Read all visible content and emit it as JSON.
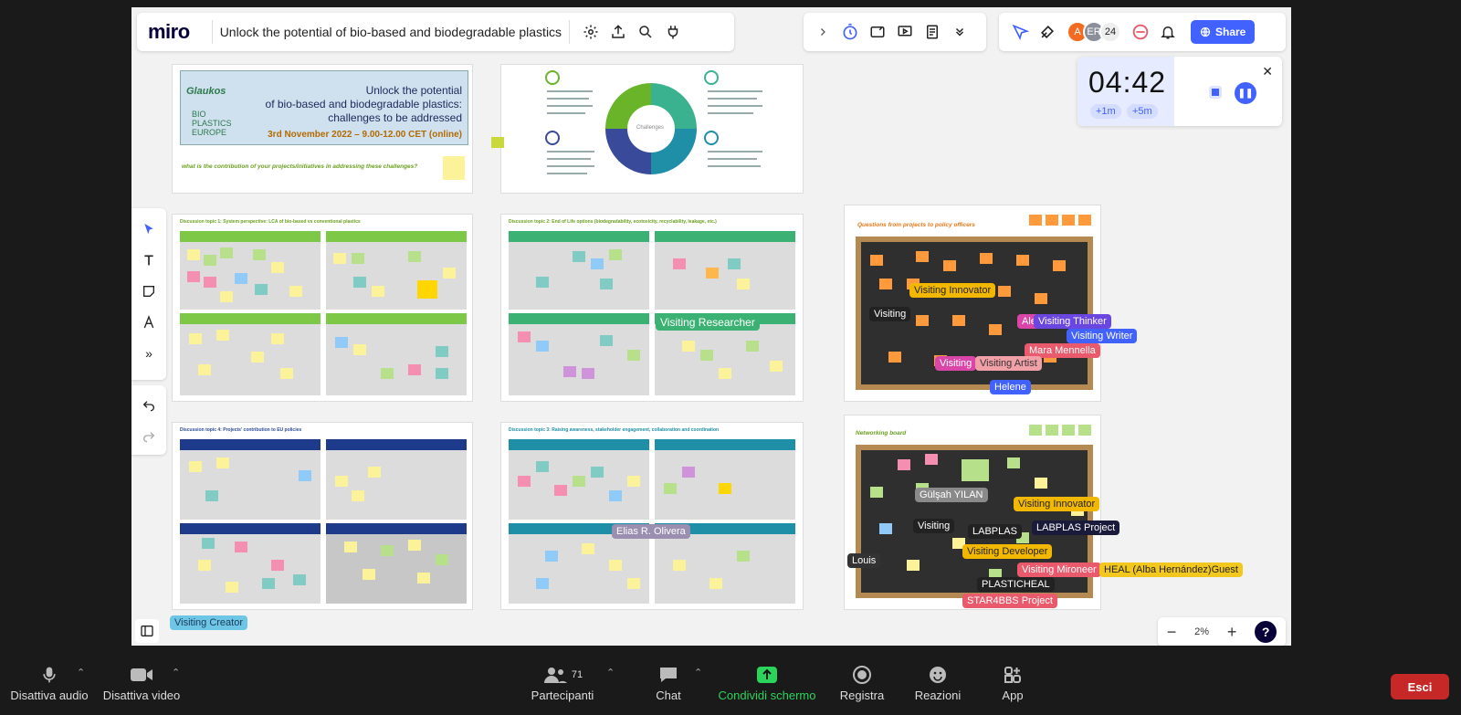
{
  "app": {
    "logo": "miro",
    "board_title": "Unlock the potential of bio-based and biodegradable plastics"
  },
  "topbar": {
    "avatar_count": "24",
    "share_label": "Share",
    "avatars": [
      {
        "initials": "A",
        "color": "#f26b21"
      },
      {
        "initials": "ER",
        "color": "#8a8f99"
      }
    ]
  },
  "timer": {
    "time": "04:42",
    "add1": "+1m",
    "add5": "+5m"
  },
  "zoom": {
    "level": "2%"
  },
  "frames": {
    "banner": {
      "title_line1": "Unlock the potential",
      "title_line2": "of bio-based and biodegradable plastics:",
      "title_line3": "challenges to be addressed",
      "date": "3rd November 2022 – 9.00-12.00 CET (online)",
      "question": "what is the contribution of your projects/initiatives in addressing these challenges?",
      "logo_text": "Glaukos",
      "bp_text": "BIO PLASTICS EUROPE"
    },
    "topic1": "Discussion topic 1: System perspective: LCA of bio-based vs conventional plastics",
    "topic2": "Discussion topic 2: End of Life options (biodegradability, ecotoxicity, recyclability, leakage, etc.)",
    "topic4": "Discussion topic 4: Projects' contribution to EU policies",
    "topic3": "Discussion topic 3: Raising awareness, stakeholder engagement, collaboration and coordination",
    "questions": "Questions from projects to policy officers",
    "networking": "Networking board",
    "wheel_center": "Challenges"
  },
  "cursors": [
    {
      "label": "Visiting Researcher",
      "color": "#3bb273"
    },
    {
      "label": "Visiting Innovator",
      "color": "#f2b800"
    },
    {
      "label": "Visiting",
      "color": "#222"
    },
    {
      "label": "Ale",
      "color": "#d946a8"
    },
    {
      "label": "Visiting Thinker",
      "color": "#6b46e0"
    },
    {
      "label": "Visiting Writer",
      "color": "#4262ff"
    },
    {
      "label": "Mara Mennella",
      "color": "#e85a6c"
    },
    {
      "label": "Visiting",
      "color": "#d946a8"
    },
    {
      "label": "Visiting Artist",
      "color": "#f2a0a8"
    },
    {
      "label": "Helene",
      "color": "#4262ff"
    },
    {
      "label": "Elias R. Olivera",
      "color": "#9a8fb0"
    },
    {
      "label": "Gülşah YILAN",
      "color": "#8a8a8a"
    },
    {
      "label": "Visiting Innovator",
      "color": "#f2b800"
    },
    {
      "label": "Visiting",
      "color": "#222"
    },
    {
      "label": "LABPLAS",
      "color": "#222"
    },
    {
      "label": "LABPLAS Project",
      "color": "#1a1a3a"
    },
    {
      "label": "Visiting Developer",
      "color": "#f2b800"
    },
    {
      "label": "Louis",
      "color": "#333"
    },
    {
      "label": "Visiting Mironeer",
      "color": "#e85a6c"
    },
    {
      "label": "HEAL (Alba Hernández)Guest",
      "color": "#f2c81e"
    },
    {
      "label": "PLASTICHEAL",
      "color": "#222"
    },
    {
      "label": "STAR4BBS Project",
      "color": "#e85a6c"
    },
    {
      "label": "Visiting Creator",
      "color": "#6ec6e6"
    }
  ],
  "bottombar": {
    "audio": "Disattiva audio",
    "video": "Disattiva video",
    "participants": "Partecipanti",
    "participants_count": "71",
    "chat": "Chat",
    "share_screen": "Condividi schermo",
    "record": "Registra",
    "reactions": "Reazioni",
    "apps": "App",
    "leave": "Esci"
  }
}
